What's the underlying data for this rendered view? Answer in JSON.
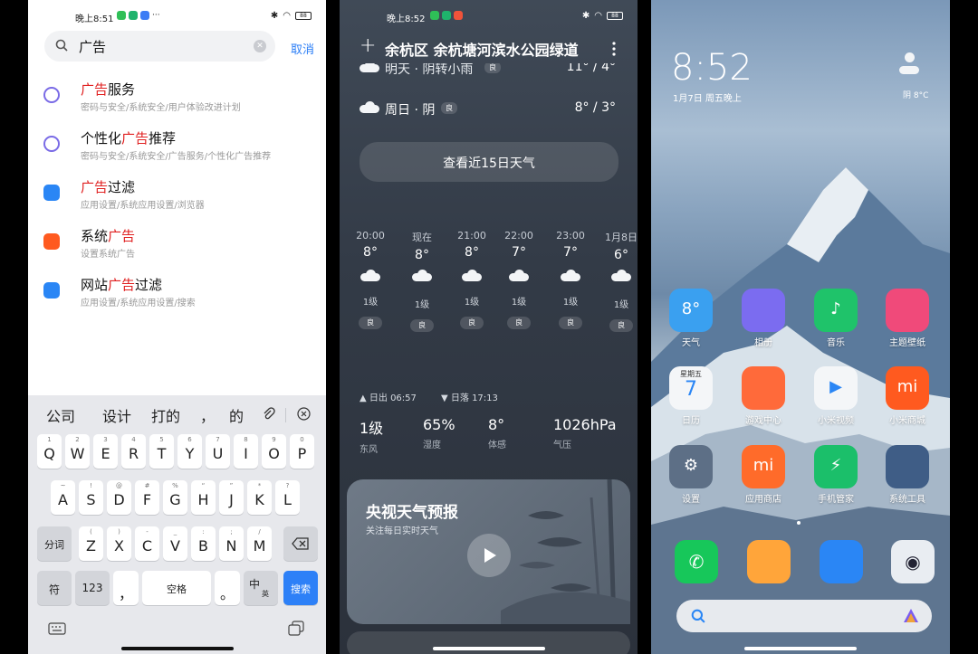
{
  "screen1": {
    "status_time": "晚上8:51",
    "search_query": "广告",
    "cancel_label": "取消",
    "results": [
      {
        "pre": "",
        "hl": "广告",
        "post": "服务",
        "sub": "密码与安全/系统安全/用户体验改进计划",
        "icon": "fingerprint-icon",
        "color": "#7a6be6"
      },
      {
        "pre": "个性化",
        "hl": "广告",
        "post": "推荐",
        "sub": "密码与安全/系统安全/广告服务/个性化广告推荐",
        "icon": "fingerprint-icon",
        "color": "#7a6be6"
      },
      {
        "pre": "",
        "hl": "广告",
        "post": "过滤",
        "sub": "应用设置/系统应用设置/浏览器",
        "icon": "browser-icon",
        "color": "#2a86f5"
      },
      {
        "pre": "系统",
        "hl": "广告",
        "post": "",
        "sub": "设置系统广告",
        "icon": "mi-icon",
        "color": "#ff5a1f"
      },
      {
        "pre": "网站",
        "hl": "广告",
        "post": "过滤",
        "sub": "应用设置/系统应用设置/搜索",
        "icon": "search-app-icon",
        "color": "#2a86f5"
      }
    ],
    "candidates": [
      "公司",
      "设计",
      "打的",
      "，",
      "的"
    ],
    "row1": [
      [
        "Q",
        "1"
      ],
      [
        "W",
        "2"
      ],
      [
        "E",
        "3"
      ],
      [
        "R",
        "4"
      ],
      [
        "T",
        "5"
      ],
      [
        "Y",
        "6"
      ],
      [
        "U",
        "7"
      ],
      [
        "I",
        "8"
      ],
      [
        "O",
        "9"
      ],
      [
        "P",
        "0"
      ]
    ],
    "row2": [
      [
        "A",
        "~"
      ],
      [
        "S",
        "!"
      ],
      [
        "D",
        "@"
      ],
      [
        "F",
        "#"
      ],
      [
        "G",
        "%"
      ],
      [
        "H",
        "“"
      ],
      [
        "J",
        "”"
      ],
      [
        "K",
        "*"
      ],
      [
        "L",
        "?"
      ]
    ],
    "row3": [
      [
        "Z",
        "("
      ],
      [
        "X",
        ")"
      ],
      [
        "C",
        "-"
      ],
      [
        "V",
        "_"
      ],
      [
        "B",
        ":"
      ],
      [
        "N",
        ";"
      ],
      [
        "M",
        "/"
      ]
    ],
    "fenci": "分词",
    "fu": "符",
    "num": "123",
    "comma": "，",
    "space": "空格",
    "period": "。",
    "zh": "中",
    "en": "英",
    "search_key": "搜索"
  },
  "screen2": {
    "status_time": "晚上8:52",
    "location": "余杭区 余杭塘河滨水公园绿道",
    "day1": "明天 · 阴转小雨",
    "day1_aq": "良",
    "day1_temp": "11° / 4°",
    "day2": "周日 · 阴",
    "day2_aq": "良",
    "day2_temp": "8° / 3°",
    "btn15": "查看近15日天气",
    "hours": [
      {
        "t": "20:00",
        "temp": "8°",
        "wind": "1级",
        "aq": "良"
      },
      {
        "t": "现在",
        "temp": "8°",
        "wind": "1级",
        "aq": "良"
      },
      {
        "t": "21:00",
        "temp": "8°",
        "wind": "1级",
        "aq": "良"
      },
      {
        "t": "22:00",
        "temp": "7°",
        "wind": "1级",
        "aq": "良"
      },
      {
        "t": "23:00",
        "temp": "7°",
        "wind": "1级",
        "aq": "良"
      },
      {
        "t": "1月8日",
        "temp": "6°",
        "wind": "1级",
        "aq": "良"
      }
    ],
    "sunrise": "日出 06:57",
    "sunset": "日落 17:13",
    "stats": [
      {
        "v": "1级",
        "l": "东风"
      },
      {
        "v": "65%",
        "l": "湿度"
      },
      {
        "v": "8°",
        "l": "体感"
      },
      {
        "v": "1026hPa",
        "l": "气压"
      }
    ],
    "card_title": "央视天气预报",
    "card_sub": "关注每日实时天气"
  },
  "screen3": {
    "time": "8:52",
    "date": "1月7日 周五晚上",
    "weather": "阴 8°C",
    "apps": [
      {
        "name": "天气",
        "color": "#3aa0f0",
        "glyph": "8°"
      },
      {
        "name": "相册",
        "color": "#7b6cf0",
        "glyph": ""
      },
      {
        "name": "音乐",
        "color": "#1fc36a",
        "glyph": "♪"
      },
      {
        "name": "主题壁纸",
        "color": "#f04a7a",
        "glyph": ""
      },
      {
        "name": "日历",
        "color": "#f4f6f8",
        "glyph": "7",
        "sub": "星期五"
      },
      {
        "name": "游戏中心",
        "color": "#ff6a3a",
        "glyph": ""
      },
      {
        "name": "小米视频",
        "color": "#f4f6f8",
        "glyph": "▶"
      },
      {
        "name": "小米商城",
        "color": "#ff5a1f",
        "glyph": "mi"
      },
      {
        "name": "设置",
        "color": "#5d6f86",
        "glyph": "⚙"
      },
      {
        "name": "应用商店",
        "color": "#ff6b2a",
        "glyph": "mi"
      },
      {
        "name": "手机管家",
        "color": "#1bbf6a",
        "glyph": "⚡"
      },
      {
        "name": "系统工具",
        "color": "#3f5d86",
        "glyph": ""
      }
    ],
    "dock": [
      {
        "name": "phone",
        "color": "#17c75a",
        "glyph": "✆"
      },
      {
        "name": "messages",
        "color": "#ffa53a",
        "glyph": ""
      },
      {
        "name": "browser",
        "color": "#2a86f5",
        "glyph": ""
      },
      {
        "name": "camera",
        "color": "#e9edf2",
        "glyph": "◉"
      }
    ]
  }
}
